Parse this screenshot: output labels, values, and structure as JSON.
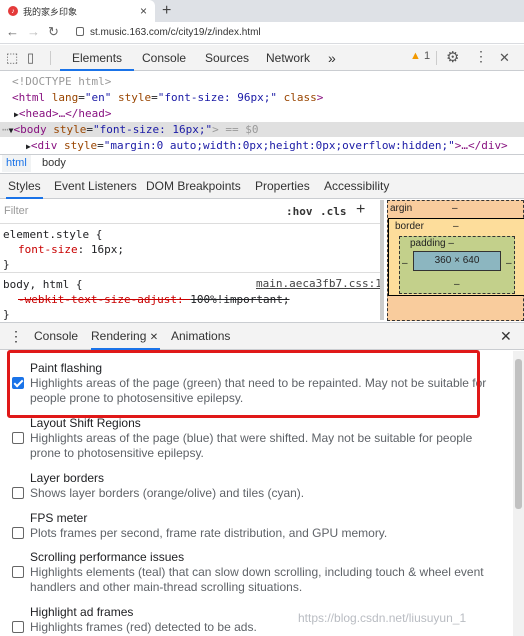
{
  "browser": {
    "tab_title": "我的家乡印象",
    "url": "st.music.163.com/c/city19/z/index.html"
  },
  "devtools": {
    "tabs": [
      "Elements",
      "Console",
      "Sources",
      "Network"
    ],
    "more": "»",
    "warning_count": "1",
    "close": "✕"
  },
  "elements": {
    "doctype": "<!DOCTYPE html>",
    "html_open": "<html",
    "html_attr1": "lang",
    "html_val1": "\"en\"",
    "html_attr2": "style",
    "html_val2": "\"font-size: 96px;\"",
    "html_attr3": "class",
    "html_close": ">",
    "head_line": "<head>…</head>",
    "body_open": "<body",
    "body_attr": "style",
    "body_val": "\"font-size: 16px;\"",
    "body_close": "> == $0",
    "div_open": "<div",
    "div_attr": "style",
    "div_val": "\"margin:0 auto;width:0px;height:0px;overflow:hidden;\"",
    "div_close": ">…</div>"
  },
  "breadcrumbs": [
    "html",
    "body"
  ],
  "styles_tabs": [
    "Styles",
    "Event Listeners",
    "DOM Breakpoints",
    "Properties",
    "Accessibility"
  ],
  "styles": {
    "filter_placeholder": "Filter",
    "hov": ":hov",
    "cls": ".cls",
    "plus": "+",
    "rule1_selector": "element.style {",
    "rule1_prop": "font-size",
    "rule1_value": "16px;",
    "rule_close": "}",
    "rule2_selector": "body, html {",
    "rule2_source": "main.aeca3fb7.css:1",
    "rule2_prop": "-webkit-text-size-adjust",
    "rule2_value": "100%!important;"
  },
  "box_model": {
    "margin_label": "argin",
    "margin_value": "–",
    "border_label": "border",
    "border_value": "–",
    "padding_label": "padding –",
    "content_size": "360 × 640",
    "side_value": "–"
  },
  "drawer": {
    "tabs": [
      "Console",
      "Rendering",
      "Animations"
    ],
    "close": "✕"
  },
  "rendering": {
    "options": [
      {
        "title": "Paint flashing",
        "desc": "Highlights areas of the page (green) that need to be repainted. May not be suitable for people prone to photosensitive epilepsy.",
        "checked": true
      },
      {
        "title": "Layout Shift Regions",
        "desc": "Highlights areas of the page (blue) that were shifted. May not be suitable for people prone to photosensitive epilepsy.",
        "checked": false
      },
      {
        "title": "Layer borders",
        "desc": "Shows layer borders (orange/olive) and tiles (cyan).",
        "checked": false
      },
      {
        "title": "FPS meter",
        "desc": "Plots frames per second, frame rate distribution, and GPU memory.",
        "checked": false
      },
      {
        "title": "Scrolling performance issues",
        "desc": "Highlights elements (teal) that can slow down scrolling, including touch & wheel event handlers and other main-thread scrolling situations.",
        "checked": false
      },
      {
        "title": "Highlight ad frames",
        "desc": "Highlights frames (red) detected to be ads.",
        "checked": false
      }
    ]
  },
  "watermark": "https://blog.csdn.net/liusuyun_1"
}
